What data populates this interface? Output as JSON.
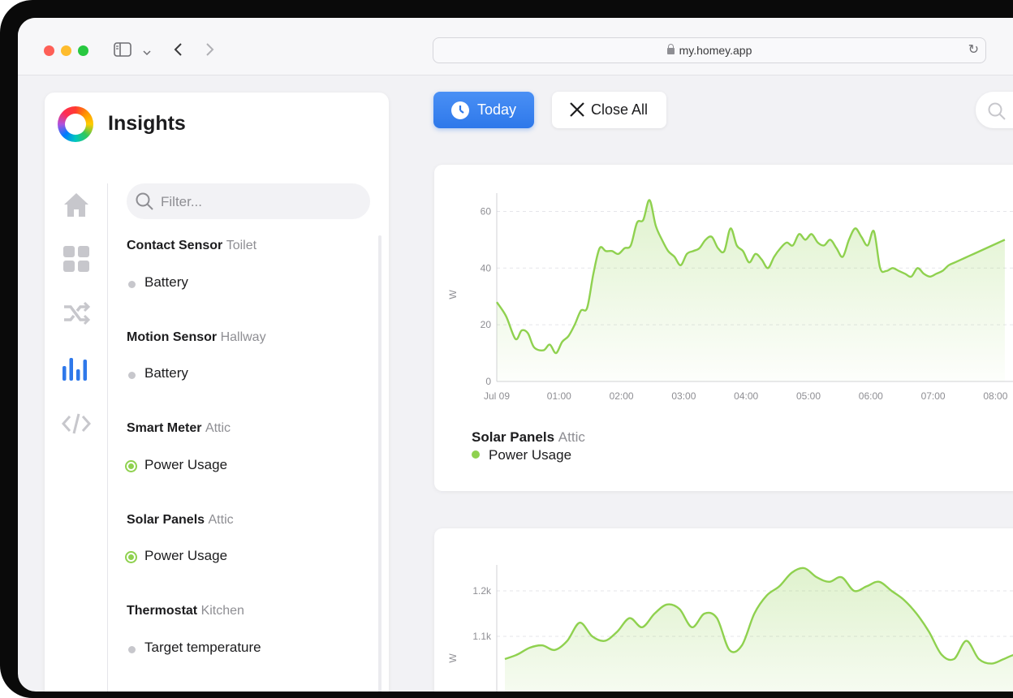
{
  "browser": {
    "url": "my.homey.app"
  },
  "sidebar": {
    "title": "Insights",
    "filter_placeholder": "Filter...",
    "nav": [
      "home-icon",
      "dashboard-icon",
      "flows-icon",
      "insights-icon",
      "code-icon"
    ],
    "groups": [
      {
        "device": "Contact Sensor",
        "zone": "Toilet",
        "items": [
          {
            "label": "Battery",
            "active": false
          }
        ]
      },
      {
        "device": "Motion Sensor",
        "zone": "Hallway",
        "items": [
          {
            "label": "Battery",
            "active": false
          }
        ]
      },
      {
        "device": "Smart Meter",
        "zone": "Attic",
        "items": [
          {
            "label": "Power Usage",
            "active": true
          }
        ]
      },
      {
        "device": "Solar Panels",
        "zone": "Attic",
        "items": [
          {
            "label": "Power Usage",
            "active": true
          }
        ]
      },
      {
        "device": "Thermostat",
        "zone": "Kitchen",
        "items": [
          {
            "label": "Target temperature",
            "active": false
          }
        ]
      }
    ]
  },
  "toolbar": {
    "today_label": "Today",
    "close_all_label": "Close All"
  },
  "colors": {
    "accent": "#2e78ea",
    "series": "#8fd14f"
  },
  "chart_data": [
    {
      "type": "area",
      "ylabel": "W",
      "ylim": [
        0,
        65
      ],
      "yticks": [
        "0",
        "20",
        "40",
        "60"
      ],
      "xticks": [
        "Jul 09",
        "01:00",
        "02:00",
        "03:00",
        "04:00",
        "05:00",
        "06:00",
        "07:00",
        "08:00"
      ],
      "grid": true,
      "legend": {
        "device": "Solar Panels",
        "zone": "Attic",
        "series": "Power Usage"
      },
      "series": [
        {
          "name": "Power Usage",
          "x_hours": [
            0,
            0.15,
            0.3,
            0.4,
            0.5,
            0.6,
            0.75,
            0.85,
            0.95,
            1.05,
            1.15,
            1.25,
            1.35,
            1.45,
            1.55,
            1.65,
            1.75,
            1.85,
            1.95,
            2.05,
            2.15,
            2.25,
            2.35,
            2.45,
            2.55,
            2.65,
            2.75,
            2.85,
            2.95,
            3.05,
            3.15,
            3.25,
            3.35,
            3.45,
            3.55,
            3.65,
            3.75,
            3.85,
            3.95,
            4.05,
            4.15,
            4.25,
            4.35,
            4.45,
            4.55,
            4.65,
            4.75,
            4.85,
            4.95,
            5.05,
            5.15,
            5.25,
            5.35,
            5.45,
            5.55,
            5.65,
            5.75,
            5.85,
            5.95,
            6.05,
            6.15,
            6.25,
            6.35,
            6.45,
            6.55,
            6.65,
            6.75,
            6.85,
            6.95,
            7.05,
            7.15,
            7.25,
            7.35,
            7.45,
            7.55,
            7.65,
            7.75,
            7.85,
            7.95,
            8.05,
            8.15
          ],
          "values": [
            28,
            23,
            15,
            18,
            17,
            12,
            11,
            13,
            10,
            14,
            16,
            20,
            25,
            26,
            38,
            47,
            46,
            46,
            45,
            47,
            48,
            56,
            57,
            64,
            55,
            50,
            46,
            44,
            41,
            45,
            46,
            47,
            50,
            51,
            47,
            46,
            54,
            48,
            46,
            42,
            45,
            43,
            40,
            44,
            47,
            49,
            48,
            52,
            50,
            52,
            49,
            48,
            50,
            47,
            44,
            50,
            54,
            51,
            48,
            53,
            40,
            39,
            40,
            39,
            38,
            37,
            40,
            38,
            37,
            38,
            39,
            41,
            42,
            43,
            44,
            45,
            46,
            47,
            48,
            49,
            50
          ]
        }
      ]
    },
    {
      "type": "area",
      "ylabel": "W",
      "ylim": [
        1000,
        1300
      ],
      "yticks": [
        "1.1k",
        "1.2k"
      ],
      "grid": true,
      "series": [
        {
          "name": "Power Usage",
          "values": [
            1050,
            1060,
            1075,
            1080,
            1070,
            1090,
            1130,
            1100,
            1090,
            1110,
            1140,
            1120,
            1150,
            1170,
            1160,
            1120,
            1150,
            1140,
            1070,
            1080,
            1150,
            1190,
            1210,
            1240,
            1250,
            1230,
            1220,
            1230,
            1200,
            1210,
            1220,
            1200,
            1180,
            1150,
            1110,
            1060,
            1050,
            1090,
            1050,
            1040,
            1050,
            1060,
            1050,
            1060,
            1070
          ]
        }
      ]
    }
  ]
}
